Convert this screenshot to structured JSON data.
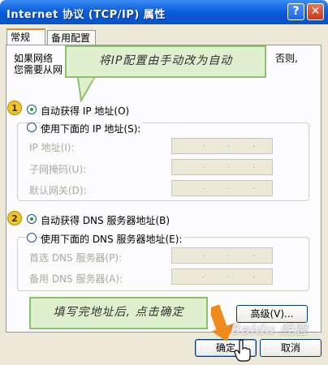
{
  "window": {
    "title": "Internet 协议 (TCP/IP) 属性",
    "help_glyph": "?",
    "close_glyph": "✕"
  },
  "tabs": [
    {
      "label": "常规",
      "active": true
    },
    {
      "label": "备用配置",
      "active": false
    }
  ],
  "intro": {
    "line1": "如果网络",
    "line1_right": "否则,",
    "line2": "您需要从网"
  },
  "ip_section": {
    "auto_label": "自动获得 IP 地址(O)",
    "auto_checked": true,
    "manual_label": "使用下面的 IP 地址(S):",
    "manual_checked": false,
    "fields": [
      {
        "label": "IP 地址(I):",
        "value": ". . ."
      },
      {
        "label": "子网掩码(U):",
        "value": ". . ."
      },
      {
        "label": "默认网关(D):",
        "value": ". . ."
      }
    ]
  },
  "dns_section": {
    "auto_label": "自动获得 DNS 服务器地址(B)",
    "auto_checked": true,
    "manual_label": "使用下面的 DNS 服务器地址(E):",
    "manual_checked": false,
    "fields": [
      {
        "label": "首选 DNS 服务器(P):",
        "value": ". . ."
      },
      {
        "label": "备用 DNS 服务器(A):",
        "value": ". . ."
      }
    ]
  },
  "buttons": {
    "advanced": "高级(V)...",
    "ok": "确定",
    "cancel": "取消"
  },
  "annotations": {
    "callout_top": "将IP配置由手动改为自动",
    "callout_bottom": "填写完地址后, 点击确定",
    "badge1": "1",
    "badge2": "2",
    "watermark": "Baidu 经验"
  },
  "colors": {
    "titlebar": "#0a5bd8",
    "dialog_bg": "#ece9d8",
    "callout_bg": "#dff0cf",
    "callout_border": "#8bc16a",
    "badge": "#f3c521",
    "arrow": "#f08a1c"
  }
}
